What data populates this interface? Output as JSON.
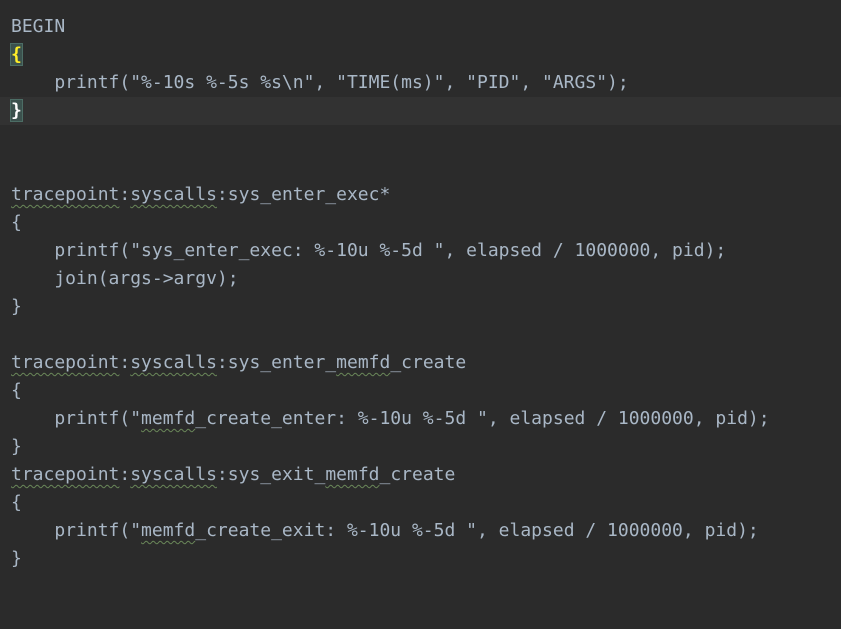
{
  "editor": {
    "lines": [
      {
        "text": "BEGIN"
      },
      {
        "text": "{"
      },
      {
        "text": "    printf(\"%-10s %-5s %s\\n\", \"TIME(ms)\", \"PID\", \"ARGS\");"
      },
      {
        "text": "}"
      },
      {
        "text": ""
      },
      {
        "text": ""
      },
      {
        "probe_a": "tracepoint",
        "sep1": ":",
        "probe_b": "syscalls",
        "sep2": ":",
        "probe_c": "sys_enter_exec*"
      },
      {
        "text": "{"
      },
      {
        "text": "    printf(\"sys_enter_exec: %-10u %-5d \", elapsed / 1000000, pid);"
      },
      {
        "text": "    join(args->argv);"
      },
      {
        "text": "}"
      },
      {
        "text": ""
      },
      {
        "probe_a": "tracepoint",
        "sep1": ":",
        "probe_b": "syscalls",
        "sep2": ":",
        "probe_c1": "sys_enter_",
        "probe_c2": "memfd",
        "probe_c3": "_create"
      },
      {
        "text": "{"
      },
      {
        "pre": "    printf(\"",
        "squig": "memfd",
        "post": "_create_enter: %-10u %-5d \", elapsed / 1000000, pid);"
      },
      {
        "text": "}"
      },
      {
        "probe_a": "tracepoint",
        "sep1": ":",
        "probe_b": "syscalls",
        "sep2": ":",
        "probe_c1": "sys_exit_",
        "probe_c2": "memfd",
        "probe_c3": "_create"
      },
      {
        "text": "{"
      },
      {
        "pre": "    printf(\"",
        "squig": "memfd",
        "post": "_create_exit: %-10u %-5d \", elapsed / 1000000, pid);"
      },
      {
        "text": "}"
      }
    ]
  }
}
